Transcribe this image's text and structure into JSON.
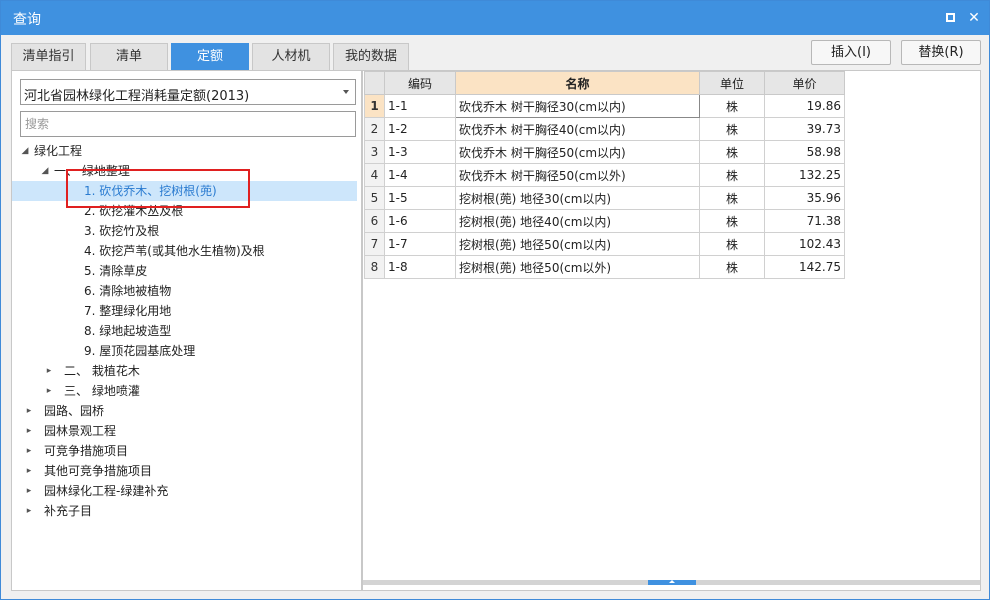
{
  "window": {
    "title": "查询"
  },
  "tabs": [
    "清单指引",
    "清单",
    "定额",
    "人材机",
    "我的数据"
  ],
  "buttons": {
    "insert": "插入(I)",
    "replace": "替换(R)"
  },
  "left": {
    "library": "河北省园林绿化工程消耗量定额(2013)",
    "search_placeholder": "搜索",
    "tree": [
      {
        "label": "绿化工程",
        "toggle": "◢"
      },
      {
        "label": "一、  绿地整理",
        "toggle": "◢"
      },
      {
        "label": "1. 砍伐乔木、挖树根(蔸)"
      },
      {
        "label": "2. 砍挖灌木丛及根"
      },
      {
        "label": "3. 砍挖竹及根"
      },
      {
        "label": "4. 砍挖芦苇(或其他水生植物)及根"
      },
      {
        "label": "5. 清除草皮"
      },
      {
        "label": "6. 清除地被植物"
      },
      {
        "label": "7. 整理绿化用地"
      },
      {
        "label": "8. 绿地起坡造型"
      },
      {
        "label": "9. 屋顶花园基底处理"
      },
      {
        "label": "二、  栽植花木",
        "toggle": "▸"
      },
      {
        "label": "三、  绿地喷灌",
        "toggle": "▸"
      },
      {
        "label": "园路、园桥",
        "toggle": "▸"
      },
      {
        "label": "园林景观工程",
        "toggle": "▸"
      },
      {
        "label": "可竞争措施项目",
        "toggle": "▸"
      },
      {
        "label": "其他可竞争措施项目",
        "toggle": "▸"
      },
      {
        "label": "园林绿化工程-绿建补充",
        "toggle": "▸"
      },
      {
        "label": "补充子目",
        "toggle": "▸"
      }
    ]
  },
  "table": {
    "columns": [
      "编码",
      "名称",
      "单位",
      "单价"
    ],
    "rows": [
      {
        "n": "1",
        "code": "1-1",
        "name": "砍伐乔木 树干胸径30(cm以内)",
        "unit": "株",
        "price": "19.86"
      },
      {
        "n": "2",
        "code": "1-2",
        "name": "砍伐乔木 树干胸径40(cm以内)",
        "unit": "株",
        "price": "39.73"
      },
      {
        "n": "3",
        "code": "1-3",
        "name": "砍伐乔木 树干胸径50(cm以内)",
        "unit": "株",
        "price": "58.98"
      },
      {
        "n": "4",
        "code": "1-4",
        "name": "砍伐乔木 树干胸径50(cm以外)",
        "unit": "株",
        "price": "132.25"
      },
      {
        "n": "5",
        "code": "1-5",
        "name": "挖树根(蔸) 地径30(cm以内)",
        "unit": "株",
        "price": "35.96"
      },
      {
        "n": "6",
        "code": "1-6",
        "name": "挖树根(蔸) 地径40(cm以内)",
        "unit": "株",
        "price": "71.38"
      },
      {
        "n": "7",
        "code": "1-7",
        "name": "挖树根(蔸) 地径50(cm以内)",
        "unit": "株",
        "price": "102.43"
      },
      {
        "n": "8",
        "code": "1-8",
        "name": "挖树根(蔸) 地径50(cm以外)",
        "unit": "株",
        "price": "142.75"
      }
    ]
  },
  "colors": {
    "accent": "#3f91e0",
    "selection": "#cde6fb",
    "header_highlight": "#fbe3c4",
    "annotation": "#e02020"
  }
}
